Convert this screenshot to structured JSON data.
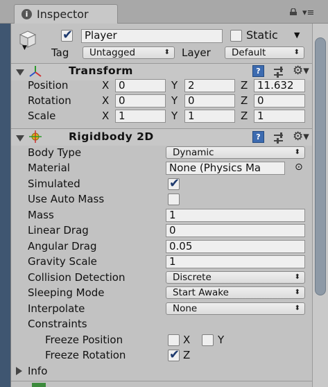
{
  "tab": {
    "title": "Inspector",
    "info_glyph": "i",
    "icon": "info-icon"
  },
  "gameobject": {
    "name": "Player",
    "static_label": "Static",
    "tag_label": "Tag",
    "tag_value": "Untagged",
    "layer_label": "Layer",
    "layer_value": "Default",
    "active": true,
    "static": false
  },
  "transform": {
    "title": "Transform",
    "help_glyph": "?",
    "position_label": "Position",
    "rotation_label": "Rotation",
    "scale_label": "Scale",
    "axis_x": "X",
    "axis_y": "Y",
    "axis_z": "Z",
    "position": {
      "x": "0",
      "y": "2",
      "z": "11.632"
    },
    "rotation": {
      "x": "0",
      "y": "0",
      "z": "0"
    },
    "scale": {
      "x": "1",
      "y": "1",
      "z": "1"
    }
  },
  "rigidbody": {
    "title": "Rigidbody 2D",
    "help_glyph": "?",
    "body_type_label": "Body Type",
    "body_type": "Dynamic",
    "material_label": "Material",
    "material": "None (Physics Ma",
    "simulated_label": "Simulated",
    "simulated": true,
    "use_auto_mass_label": "Use Auto Mass",
    "use_auto_mass": false,
    "mass_label": "Mass",
    "mass": "1",
    "linear_drag_label": "Linear Drag",
    "linear_drag": "0",
    "angular_drag_label": "Angular Drag",
    "angular_drag": "0.05",
    "gravity_scale_label": "Gravity Scale",
    "gravity_scale": "1",
    "collision_detection_label": "Collision Detection",
    "collision_detection": "Discrete",
    "sleeping_mode_label": "Sleeping Mode",
    "sleeping_mode": "Start Awake",
    "interpolate_label": "Interpolate",
    "interpolate": "None",
    "constraints_label": "Constraints",
    "freeze_position_label": "Freeze Position",
    "freeze_position_x": false,
    "freeze_position_y": false,
    "freeze_rotation_label": "Freeze Rotation",
    "freeze_rotation_z": true,
    "x_label": "X",
    "y_label": "Y",
    "z_label": "Z",
    "info_label": "Info"
  },
  "glyphs": {
    "check": "✔",
    "dropdown": "⬍",
    "gear": "⚙▾",
    "menu": "▾≡",
    "target": "⊙"
  },
  "colors": {
    "panel": "#c2c2c2",
    "help_icon": "#3d6bb0",
    "check": "#1e3a6e",
    "scroll_thumb": "#8d99a6",
    "left_strip": "#3f5671"
  }
}
